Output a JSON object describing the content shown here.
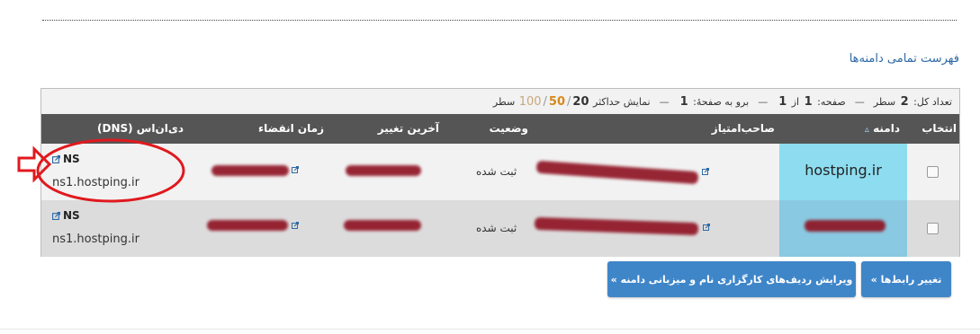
{
  "page": {
    "title": "فهرست تمامی دامنه‌ها"
  },
  "pager": {
    "total_label": "تعداد کل:",
    "total_value": "2",
    "rows_word": "سطر",
    "page_label": "صفحه:",
    "page_value": "1",
    "of_word": "از",
    "page_count": "1",
    "goto_label": "برو به صفحهٔ:",
    "goto_value": "1",
    "max_label": "نمایش حداکثر",
    "options": [
      "20",
      "50",
      "100"
    ],
    "option_sep": "/",
    "rows_suffix": "سطر"
  },
  "table": {
    "columns": {
      "select": "انتخاب",
      "domain": "دامنه",
      "domain_sort": "▵",
      "owner": "صاحب‌امتیاز",
      "status": "وضعیت",
      "last_change": "آخرین تغییر",
      "expiry": "زمان انقضاء",
      "dns": "دی‌ان‌اس (DNS)"
    },
    "rows": [
      {
        "domain": "hostping.ir",
        "status": "ثبت شده",
        "ns_label": "NS",
        "ns_host": "ns1.hostping.ir"
      },
      {
        "domain": "",
        "status": "ثبت شده",
        "ns_label": "NS",
        "ns_host": "ns1.hostping.ir"
      }
    ]
  },
  "buttons": {
    "change_links": "تغییر رابط‌ها »",
    "edit_records": "ویرایش ردیف‌های کارگزاری نام و میزبانی دامنه »"
  },
  "colors": {
    "header_bg": "#555555",
    "domain_highlight": "#8ddcef",
    "button": "#3f86c9",
    "redaction": "#8e1020",
    "annotation": "#e0191e",
    "max_option": "#d68a1a"
  }
}
